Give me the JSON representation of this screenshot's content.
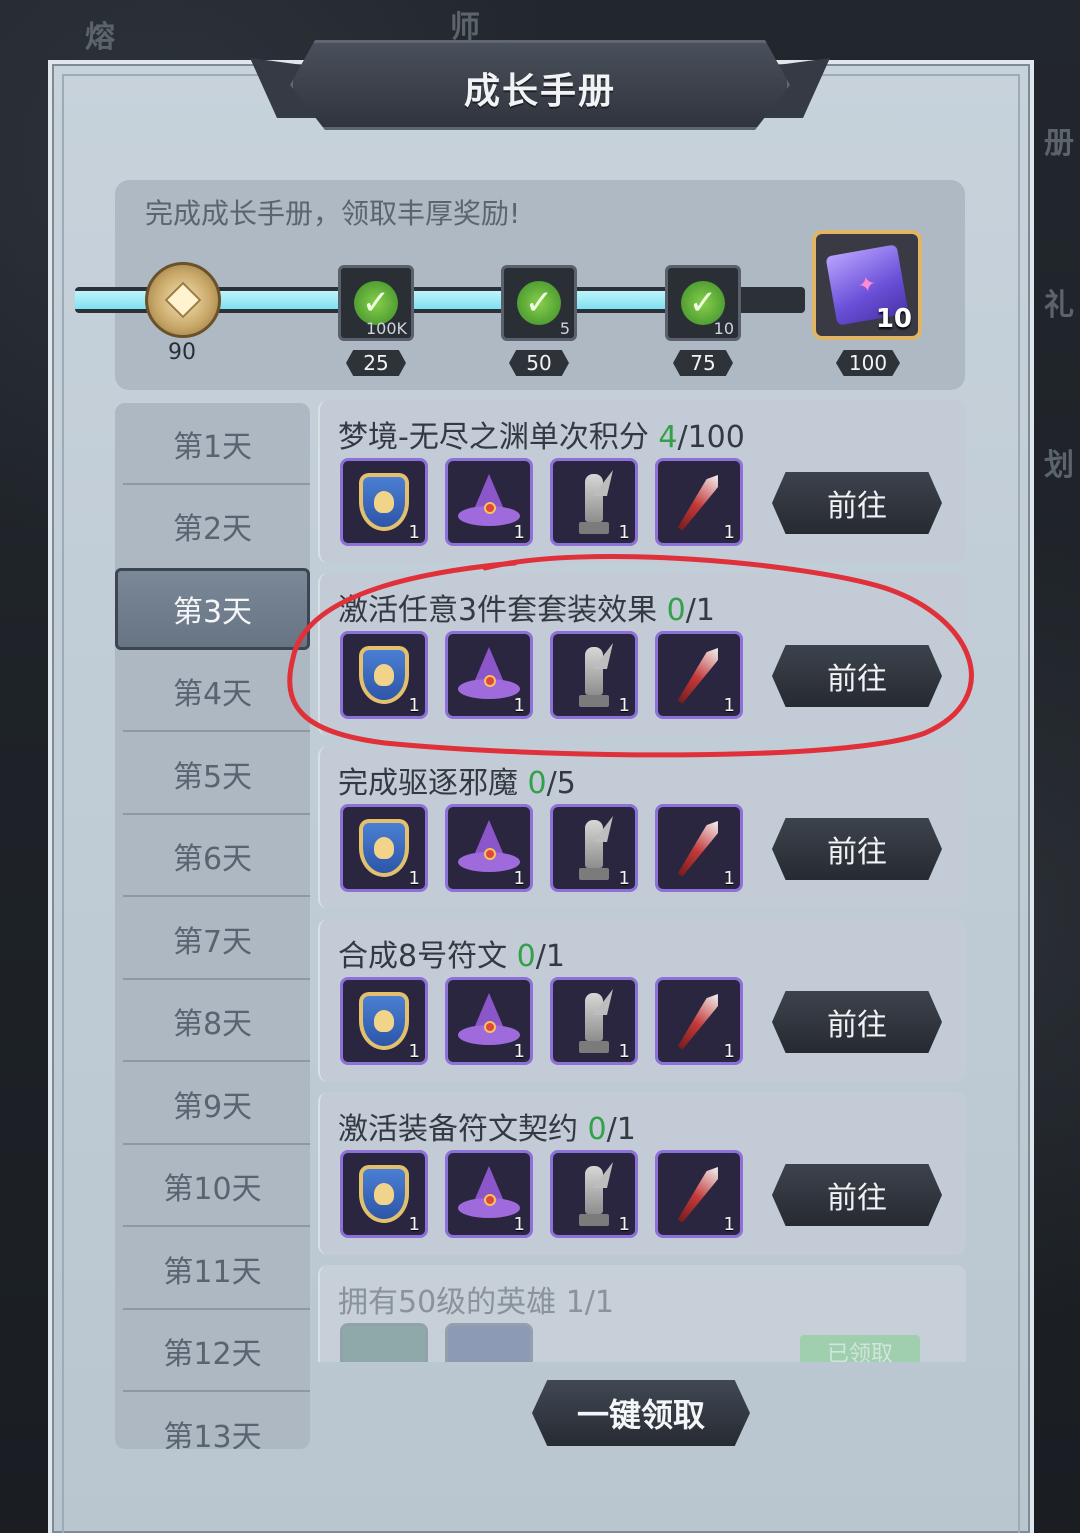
{
  "background": {
    "text_left": "熔",
    "text_top": "师",
    "text_right_1": "册",
    "text_right_2": "礼",
    "text_right_3": "划"
  },
  "panel": {
    "title": "成长手册",
    "description": "完成成长手册，领取丰厚奖励!"
  },
  "progress": {
    "current_value": "90",
    "fill_fraction": 0.9,
    "milestones": [
      {
        "threshold": "25",
        "item_qty": "100K",
        "icon": "gold-coin-icon",
        "claimed": true
      },
      {
        "threshold": "50",
        "item_qty": "5",
        "icon": "potion-icon",
        "claimed": true
      },
      {
        "threshold": "75",
        "item_qty": "10",
        "icon": "scroll-icon",
        "claimed": true
      }
    ],
    "final_reward": {
      "threshold": "100",
      "item_qty": "10",
      "icon": "purple-scroll-icon"
    }
  },
  "days": [
    {
      "label": "第1天"
    },
    {
      "label": "第2天"
    },
    {
      "label": "第3天",
      "active": true
    },
    {
      "label": "第4天"
    },
    {
      "label": "第5天"
    },
    {
      "label": "第6天"
    },
    {
      "label": "第7天"
    },
    {
      "label": "第8天"
    },
    {
      "label": "第9天"
    },
    {
      "label": "第10天"
    },
    {
      "label": "第11天"
    },
    {
      "label": "第12天"
    },
    {
      "label": "第13天"
    }
  ],
  "reward_qty": "1",
  "goto_label": "前往",
  "tasks": [
    {
      "title": "梦境-无尽之渊单次积分 ",
      "progress_done": "4",
      "progress_total": "/100"
    },
    {
      "title": "激活任意3件套套装效果 ",
      "progress_done": "0",
      "progress_total": "/1"
    },
    {
      "title": "完成驱逐邪魔 ",
      "progress_done": "0",
      "progress_total": "/5"
    },
    {
      "title": "合成8号符文 ",
      "progress_done": "0",
      "progress_total": "/1"
    },
    {
      "title": "激活装备符文契约 ",
      "progress_done": "0",
      "progress_total": "/1"
    },
    {
      "title": "拥有50级的英雄 1/1",
      "status": "已领取"
    }
  ],
  "claim_all_label": "一键领取",
  "colors": {
    "annotation": "#e0303a",
    "progress_done": "#33a04a",
    "item_border": "#8d71d8"
  }
}
